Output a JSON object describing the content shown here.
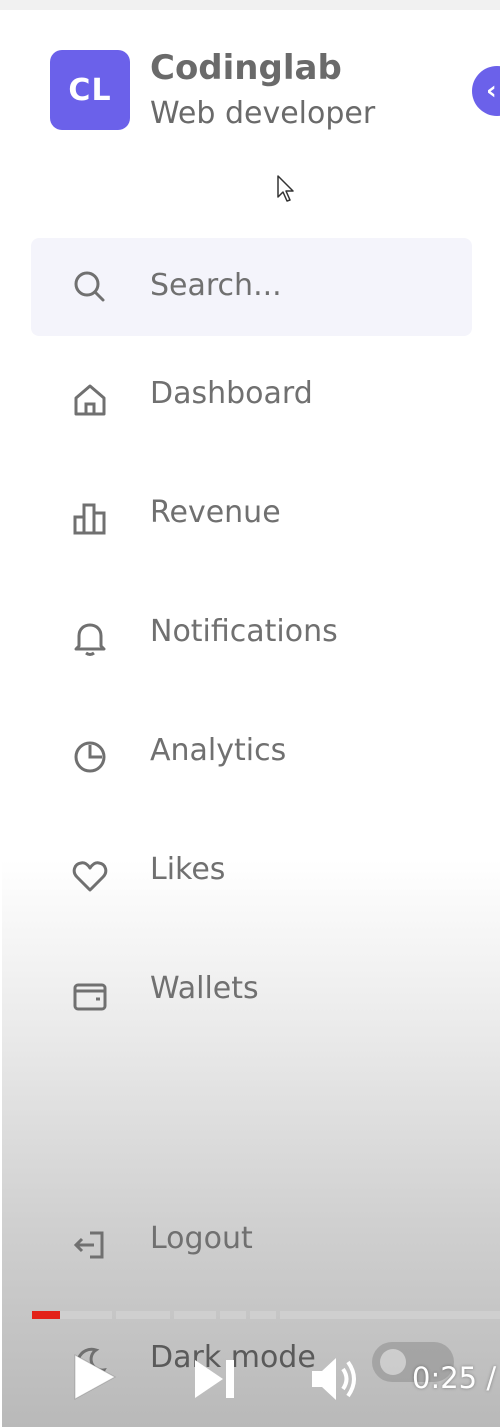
{
  "brand": {
    "initials": "CL",
    "name": "Codinglab",
    "role": "Web developer"
  },
  "colors": {
    "accent": "#6b61ea",
    "text": "#707070",
    "search_bg": "#f4f4fb",
    "progress_played": "#e32219"
  },
  "search": {
    "placeholder": "Search...",
    "icon": "search-icon"
  },
  "nav": [
    {
      "label": "Dashboard",
      "icon": "home-icon"
    },
    {
      "label": "Revenue",
      "icon": "bar-chart-icon"
    },
    {
      "label": "Notifications",
      "icon": "bell-icon"
    },
    {
      "label": "Analytics",
      "icon": "pie-chart-icon"
    },
    {
      "label": "Likes",
      "icon": "heart-icon"
    },
    {
      "label": "Wallets",
      "icon": "wallet-icon"
    }
  ],
  "bottom": {
    "logout_label": "Logout",
    "darkmode_label": "Dark mode",
    "darkmode_enabled": false
  },
  "video": {
    "time": "0:25 /",
    "progress_fraction": 0.06
  }
}
